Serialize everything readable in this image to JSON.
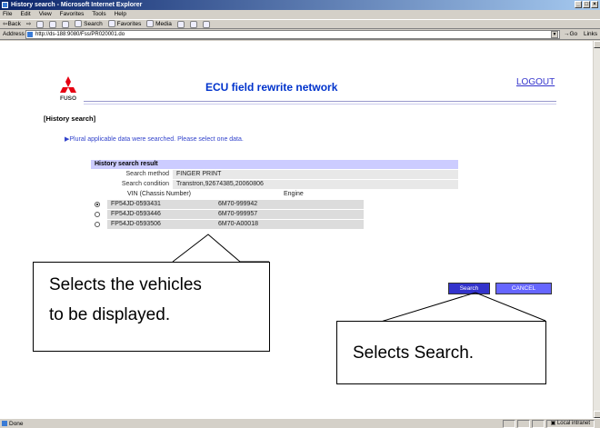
{
  "window": {
    "title": "History search - Microsoft Internet Explorer"
  },
  "menu": [
    "File",
    "Edit",
    "View",
    "Favorites",
    "Tools",
    "Help"
  ],
  "toolbar": {
    "back": "⇦Back",
    "forward": "⇨",
    "search": "Search",
    "favorites": "Favorites",
    "media": "Media"
  },
  "address": {
    "label": "Address",
    "url": "http://ds-188:9080/Fss/PR020001.do",
    "go": "Go",
    "links": "Links"
  },
  "page": {
    "brand": "FUSO",
    "title": "ECU field rewrite network",
    "logout": "LOGOUT",
    "section": "[History search]",
    "message": "Plural applicable data were searched. Please select one data.",
    "result": {
      "heading": "History search result",
      "method_label": "Search method",
      "method_value": "FINGER PRINT",
      "condition_label": "Search condition",
      "condition_value": "Transtron,92674385,20060806",
      "col_vin": "VIN (Chassis Number)",
      "col_engine": "Engine",
      "rows": [
        {
          "vin": "FP54JD-0593431",
          "engine": "6M70-999942",
          "selected": true
        },
        {
          "vin": "FP54JD-0593446",
          "engine": "6M70-999957",
          "selected": false
        },
        {
          "vin": "FP54JD-0593506",
          "engine": "6M70-A00018",
          "selected": false
        }
      ]
    },
    "buttons": {
      "search": "Search",
      "cancel": "CANCEL"
    }
  },
  "callouts": {
    "left_line1": "Selects the vehicles",
    "left_line2": "to be displayed.",
    "right": "Selects Search."
  },
  "status": {
    "left": "Done",
    "zone": "Local intranet"
  },
  "colors": {
    "title_blue": "#0033cc",
    "section_bg": "#ccccff",
    "button_blue": "#3333cc",
    "button_cancel": "#6666ff"
  }
}
